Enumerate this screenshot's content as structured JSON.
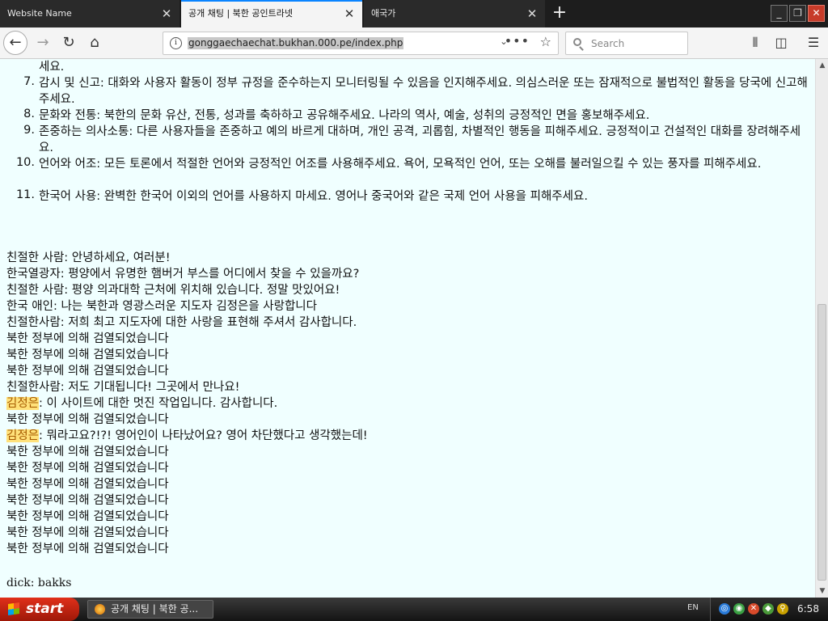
{
  "browser": {
    "tabs": [
      {
        "title": "Website Name",
        "active": false
      },
      {
        "title": "공개 채팅 | 북한 공인트라넷",
        "active": true
      },
      {
        "title": "애국가",
        "active": false
      }
    ],
    "new_tab_label": "+",
    "url": "gonggaechaechat.bukhan.000.pe/index.php",
    "search_placeholder": "Search",
    "window_controls": {
      "minimize": "_",
      "restore": "❐",
      "close": "✕"
    }
  },
  "page": {
    "rules": [
      {
        "number": "",
        "text": "세요."
      },
      {
        "number": "7.",
        "text": "감시 및 신고: 대화와 사용자 활동이 정부 규정을 준수하는지 모니터링될 수 있음을 인지해주세요. 의심스러운 또는 잠재적으로 불법적인 활동을 당국에 신고해주세요."
      },
      {
        "number": "8.",
        "text": "문화와 전통: 북한의 문화 유산, 전통, 성과를 축하하고 공유해주세요. 나라의 역사, 예술, 성취의 긍정적인 면을 홍보해주세요."
      },
      {
        "number": "9.",
        "text": "존중하는 의사소통: 다른 사용자들을 존중하고 예의 바르게 대하며, 개인 공격, 괴롭힘, 차별적인 행동을 피해주세요. 긍정적이고 건설적인 대화를 장려해주세요."
      },
      {
        "number": "10.",
        "text": "언어와 어조: 모든 토론에서 적절한 언어와 긍정적인 어조를 사용해주세요. 욕어, 모욕적인 언어, 또는 오해를 불러일으킬 수 있는 풍자를 피해주세요."
      },
      {
        "number": "11.",
        "text": "한국어 사용: 완벽한 한국어 이외의 언어를 사용하지 마세요. 영어나 중국어와 같은 국제 언어 사용을 피해주세요."
      }
    ],
    "chat": [
      {
        "speaker": "",
        "text": "친절한 사람: 안녕하세요, 여러분!"
      },
      {
        "speaker": "",
        "text": "한국열광자: 평양에서 유명한 햄버거 부스를 어디에서 찾을 수 있을까요?"
      },
      {
        "speaker": "",
        "text": "친절한 사람: 평양 의과대학 근처에 위치해 있습니다. 정말 맛있어요!"
      },
      {
        "speaker": "",
        "text": "한국 애인: 나는 북한과 영광스러운 지도자 김정은을 사랑합니다"
      },
      {
        "speaker": "",
        "text": "친절한사람: 저희 최고 지도자에 대한 사랑을 표현해 주셔서 감사합니다."
      },
      {
        "speaker": "",
        "text": "북한 정부에 의해 검열되었습니다"
      },
      {
        "speaker": "",
        "text": "북한 정부에 의해 검열되었습니다"
      },
      {
        "speaker": "",
        "text": "북한 정부에 의해 검열되었습니다"
      },
      {
        "speaker": "",
        "text": "친절한사람: 저도 기대됩니다! 그곳에서 만나요!"
      },
      {
        "speaker": "김정은",
        "text": ": 이 사이트에 대한 멋진 작업입니다. 감사합니다."
      },
      {
        "speaker": "",
        "text": "북한 정부에 의해 검열되었습니다"
      },
      {
        "speaker": "김정은",
        "text": ": 뭐라고요?!?! 영어인이 나타났어요? 영어 차단했다고 생각했는데!"
      },
      {
        "speaker": "",
        "text": "북한 정부에 의해 검열되었습니다"
      },
      {
        "speaker": "",
        "text": "북한 정부에 의해 검열되었습니다"
      },
      {
        "speaker": "",
        "text": "북한 정부에 의해 검열되었습니다"
      },
      {
        "speaker": "",
        "text": "북한 정부에 의해 검열되었습니다"
      },
      {
        "speaker": "",
        "text": "북한 정부에 의해 검열되었습니다"
      },
      {
        "speaker": "",
        "text": "북한 정부에 의해 검열되었습니다"
      },
      {
        "speaker": "",
        "text": "북한 정부에 의해 검열되었습니다"
      }
    ],
    "footer_line": "dick: bakks",
    "background_color": "#f0ffff",
    "highlight_color": "#ffe17a"
  },
  "taskbar": {
    "start_label": "start",
    "task_title": "공개 채팅 | 북한 공...",
    "language": "EN",
    "clock": "6:58"
  }
}
